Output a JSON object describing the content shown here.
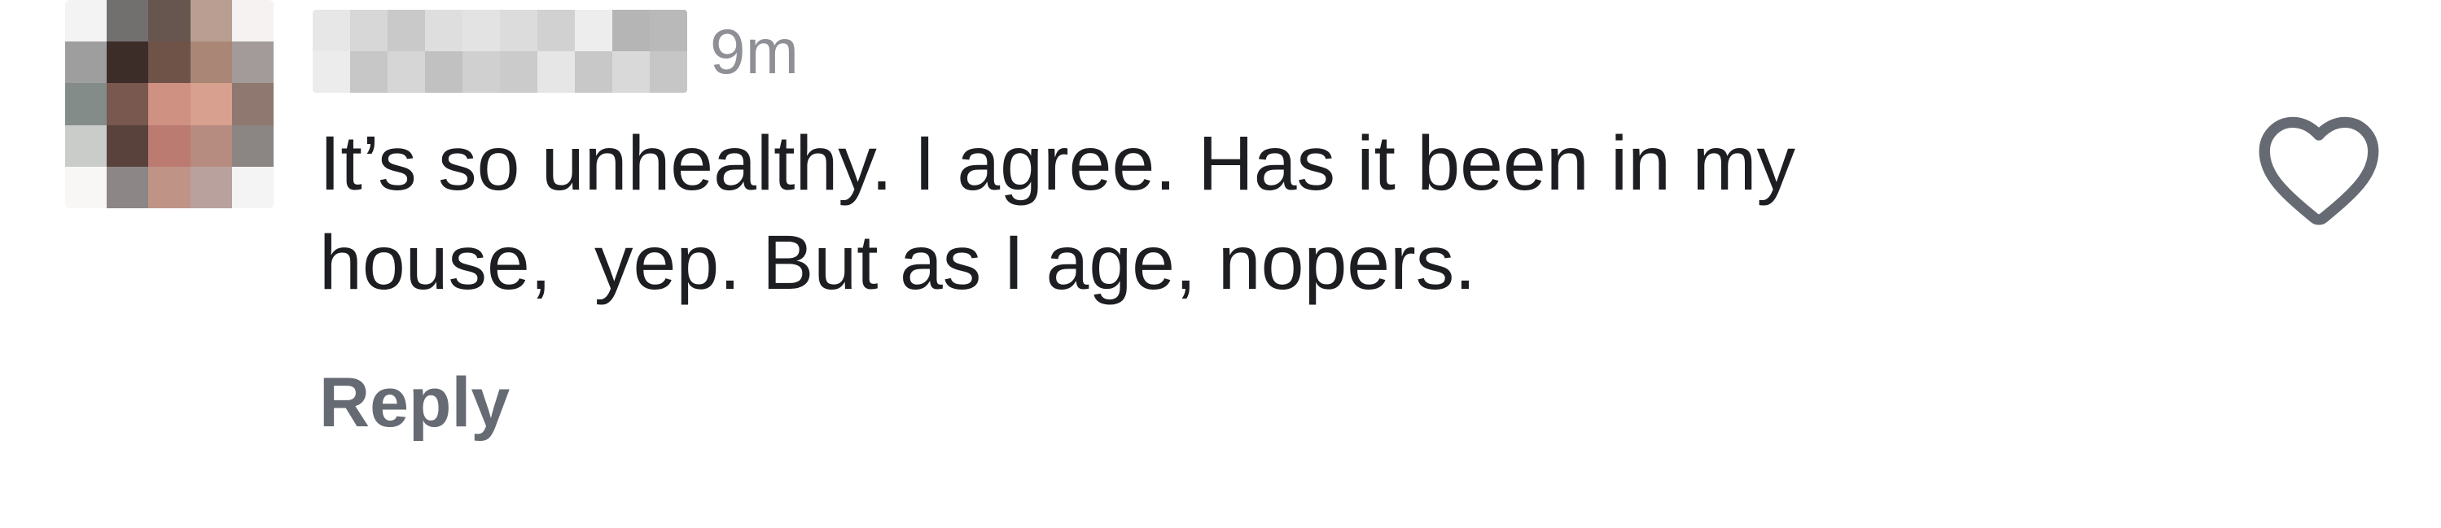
{
  "comment": {
    "timestamp": "9m",
    "text": "It’s so unhealthy. I agree. Has it been in my house,  yep. But as I age, nopers.",
    "reply_label": "Reply",
    "like_icon": "heart-outline-icon",
    "avatar_icon": "avatar-pixelated"
  },
  "colors": {
    "text_primary": "#1c1e21",
    "text_secondary": "#8e9095",
    "reply": "#666b73",
    "icon_stroke": "#666b73"
  }
}
